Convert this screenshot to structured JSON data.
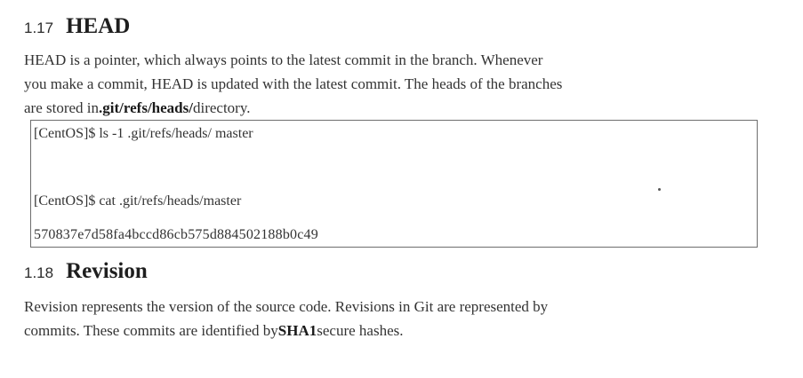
{
  "section_head": {
    "number": "1.17",
    "title": "HEAD",
    "para_line1": "HEAD is a pointer, which always points to the latest commit in the branch. Whenever",
    "para_line2": "you make a commit, HEAD is updated with the latest commit. The heads of the branches",
    "para_line3_pre": "are stored in",
    "para_line3_bold": ".git/refs/heads/",
    "para_line3_post": "directory."
  },
  "code_box": {
    "line1": "[CentOS]$ ls -1 .git/refs/heads/ master",
    "line2": "[CentOS]$ cat .git/refs/heads/master",
    "line3": "570837e7d58fa4bccd86cb575d884502188b0c49"
  },
  "section_revision": {
    "number": "1.18",
    "title": "Revision",
    "para_line1": "Revision represents the version of the source code. Revisions in Git are represented by",
    "para_line2_pre": "commits. These commits are identified by",
    "para_line2_bold": "SHA1",
    "para_line2_post": "secure hashes."
  }
}
